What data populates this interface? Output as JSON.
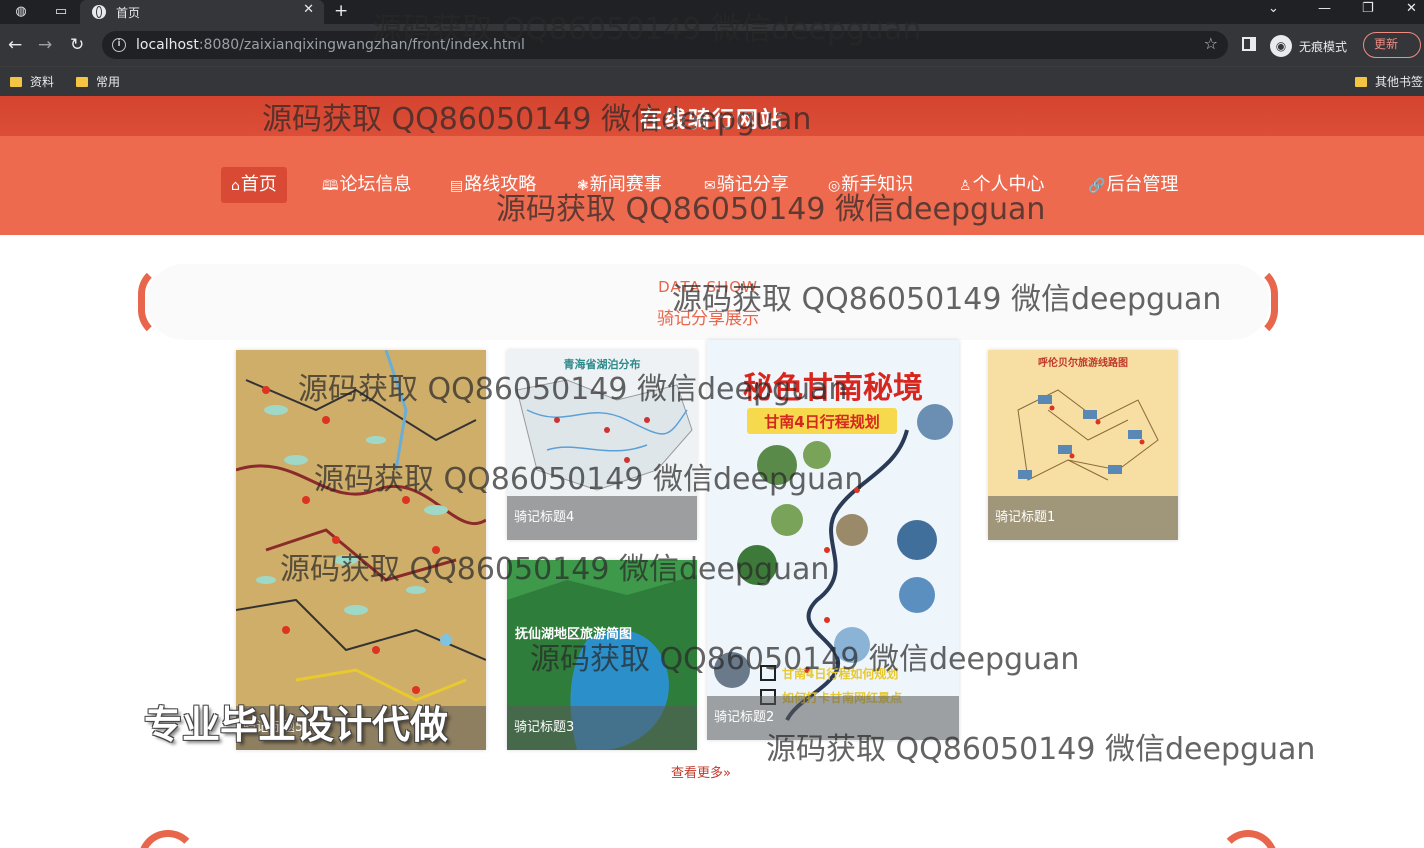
{
  "browser": {
    "tab_title": "首页",
    "url_host": "localhost",
    "url_rest": ":8080/zaixianqixingwangzhan/front/index.html",
    "incognito_label": "无痕模式",
    "update_label": "更新",
    "bookmarks": [
      "资料",
      "常用"
    ],
    "other_bookmarks": "其他书签"
  },
  "site": {
    "title": "在线骑行网站",
    "nav": [
      {
        "icon": "⌂",
        "label": "首页"
      },
      {
        "icon": "🕮",
        "label": "论坛信息"
      },
      {
        "icon": "▤",
        "label": "路线攻略"
      },
      {
        "icon": "❃",
        "label": "新闻赛事"
      },
      {
        "icon": "✉",
        "label": "骑记分享"
      },
      {
        "icon": "◎",
        "label": "新手知识"
      },
      {
        "icon": "♙",
        "label": "个人中心"
      },
      {
        "icon": "🔗",
        "label": "后台管理"
      }
    ]
  },
  "section": {
    "en_title": "DATA SHOW",
    "cn_title": "骑记分享展示",
    "cards": [
      {
        "caption": "骑记标题5"
      },
      {
        "caption": "骑记标题4"
      },
      {
        "caption": "骑记标题3"
      },
      {
        "caption": "骑记标题2"
      },
      {
        "caption": "骑记标题1"
      }
    ],
    "more_label": "查看更多»"
  },
  "posters": {
    "gannan_title": "秘色甘南秘境",
    "gannan_subtitle": "甘南4日行程规划",
    "gannan_check1": "甘南4日行程如何规划",
    "gannan_check2": "如何打卡甘南网红景点",
    "lake_title": "抚仙湖地区旅游简图",
    "hulun_title": "呼伦贝尔旅游线路图",
    "qinghai_title": "青海省湖泊分布"
  },
  "watermarks": {
    "qq_text": "源码获取 QQ86050149 微信deepguan",
    "big_text": "专业毕业设计代做"
  },
  "colors": {
    "header_red": "#d4442f",
    "nav_orange": "#ee6a4f",
    "accent": "#e8664c"
  }
}
